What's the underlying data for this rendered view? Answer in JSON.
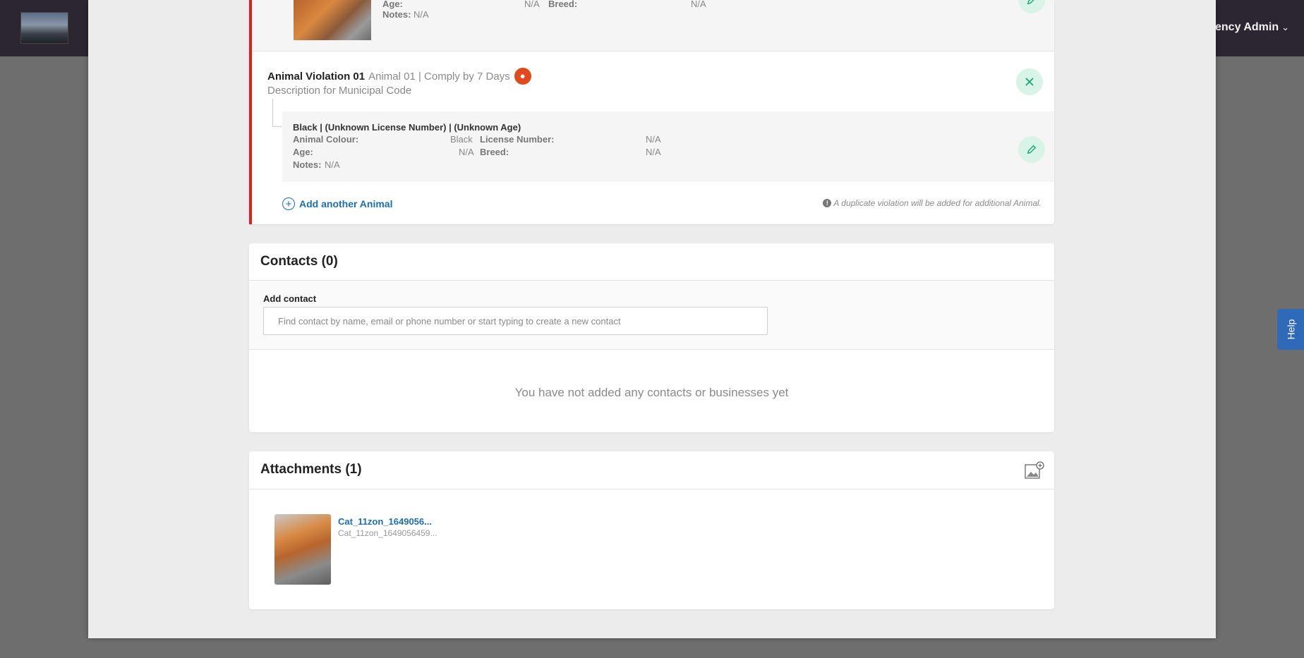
{
  "header": {
    "user_menu": "ency Admin"
  },
  "help_tab": {
    "label": "Help"
  },
  "previous_animal": {
    "age_label": "Age:",
    "age_value": "N/A",
    "breed_label": "Breed:",
    "breed_value": "N/A",
    "notes_label": "Notes:",
    "notes_value": "N/A"
  },
  "violation": {
    "title": "Animal Violation 01",
    "subtitle": "Animal 01 | Comply by 7 Days",
    "description": "Description for Municipal Code",
    "animal": {
      "title": "Black | (Unknown License Number) | (Unknown Age)",
      "colour_label": "Animal Colour:",
      "colour_value": "Black",
      "license_label": "License Number:",
      "license_value": "N/A",
      "age_label": "Age:",
      "age_value": "N/A",
      "breed_label": "Breed:",
      "breed_value": "N/A",
      "notes_label": "Notes:",
      "notes_value": "N/A"
    },
    "add_animal_label": "Add another Animal",
    "duplicate_note": "A duplicate violation will be added for additional Animal."
  },
  "contacts": {
    "title": "Contacts (0)",
    "add_label": "Add contact",
    "input_placeholder": "Find contact by name, email or phone number or start typing to create a new contact",
    "empty_message": "You have not added any contacts or businesses yet"
  },
  "attachments": {
    "title": "Attachments (1)",
    "items": [
      {
        "name": "Cat_11zon_1649056...",
        "filename": "Cat_11zon_1649056459..."
      }
    ]
  },
  "colors": {
    "accent_red": "#d9211f",
    "link_blue": "#1c6fb5",
    "action_green": "#17a673",
    "paw_orange": "#e04a1c"
  }
}
